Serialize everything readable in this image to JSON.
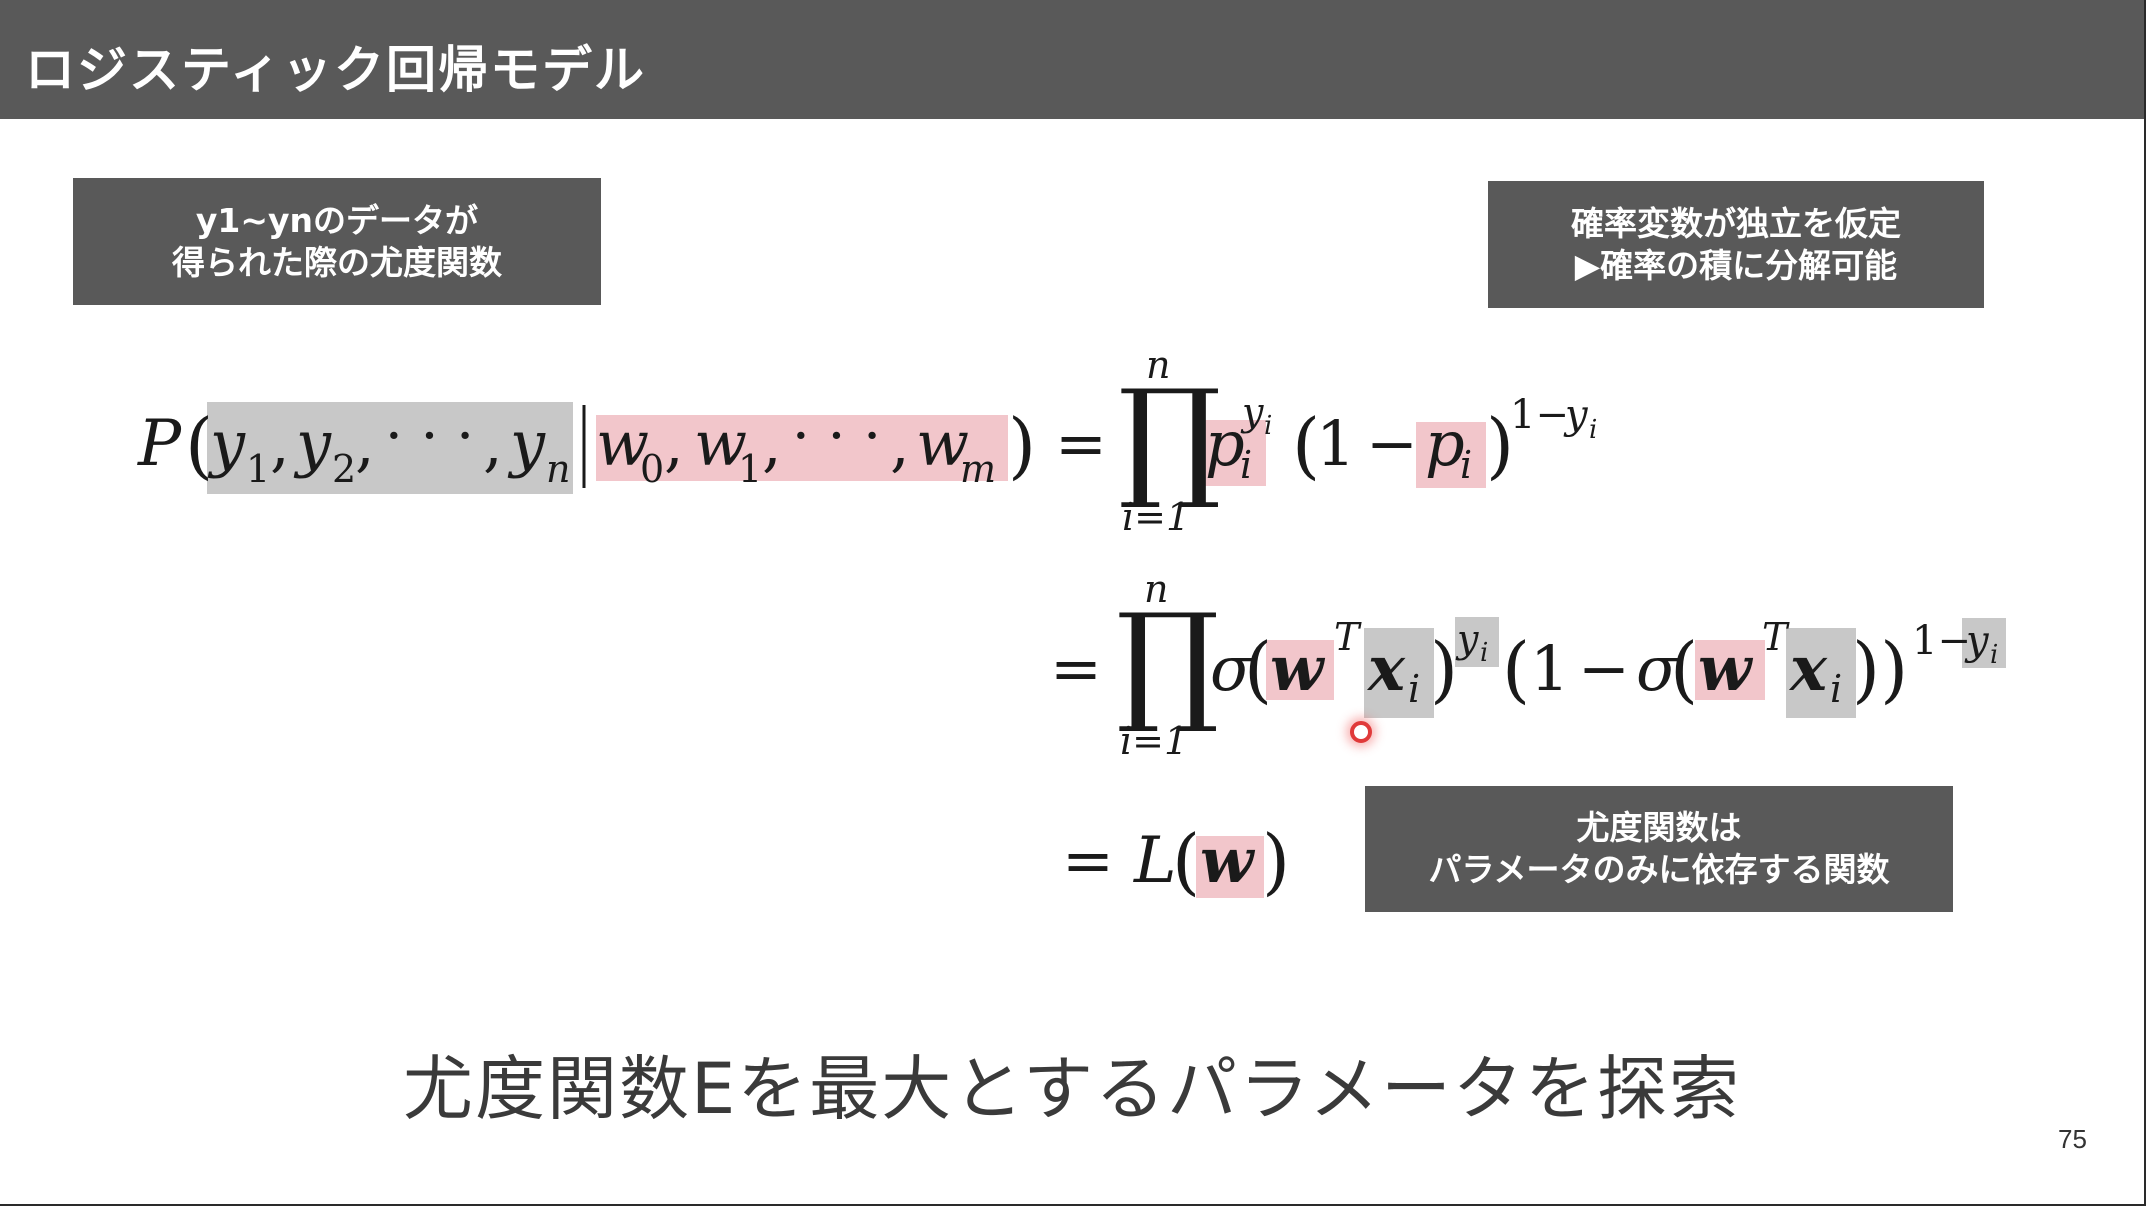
{
  "slide": {
    "title": "ロジスティック回帰モデル",
    "page_number": "75"
  },
  "callouts": {
    "likelihood": {
      "line1": "y1~ynのデータが",
      "line2": "得られた際の尤度関数"
    },
    "independence": {
      "line1": "確率変数が独立を仮定",
      "line2": "▶確率の積に分解可能"
    },
    "parameter_only": {
      "line1": "尤度関数は",
      "line2": "パラメータのみに依存する関数"
    }
  },
  "equation": {
    "lhs": "P(y₁, y₂, ⋯ , yₙ | w₀, w₁, ⋯ , wₘ)",
    "line1": "= ∏ᵢ₌₁ⁿ pᵢ^yᵢ (1 − pᵢ)^(1−yᵢ)",
    "line2": "= ∏ᵢ₌₁ⁿ σ(wᵀxᵢ)^yᵢ (1 − σ(wᵀxᵢ))^(1−yᵢ)",
    "line3": "= L(w)"
  },
  "conclusion": "尤度関数Eを最大とするパラメータを探索",
  "colors": {
    "title_bar": "#595959",
    "callout_bg": "#595959",
    "highlight_gray": "#c8c8c8",
    "highlight_pink": "#f2c6cb",
    "pointer": "#e03a3a"
  }
}
